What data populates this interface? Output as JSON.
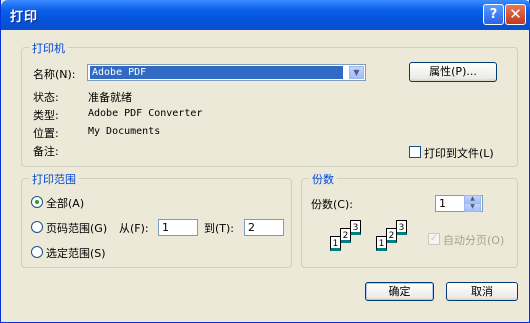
{
  "window": {
    "title": "打印",
    "help_glyph": "?",
    "close_glyph": "✕"
  },
  "printer": {
    "legend": "打印机",
    "name_label": "名称(N):",
    "name_value": "Adobe PDF",
    "properties_button": "属性(P)...",
    "status_label": "状态:",
    "status_value": "准备就绪",
    "type_label": "类型:",
    "type_value": "Adobe PDF Converter",
    "location_label": "位置:",
    "location_value": "My Documents",
    "comment_label": "备注:",
    "print_to_file": "打印到文件(L)",
    "print_to_file_checked": false
  },
  "range": {
    "legend": "打印范围",
    "all": "全部(A)",
    "pages": "页码范围(G)",
    "from_label": "从(F):",
    "from_value": "1",
    "to_label": "到(T):",
    "to_value": "2",
    "selection": "选定范围(S)",
    "selected": "all"
  },
  "copies": {
    "legend": "份数",
    "count_label": "份数(C):",
    "count_value": "1",
    "collate_label": "自动分页(O)",
    "collate_checked": true,
    "collate_enabled": false,
    "page_numbers": [
      "1",
      "2",
      "3"
    ]
  },
  "buttons": {
    "ok": "确定",
    "cancel": "取消"
  }
}
